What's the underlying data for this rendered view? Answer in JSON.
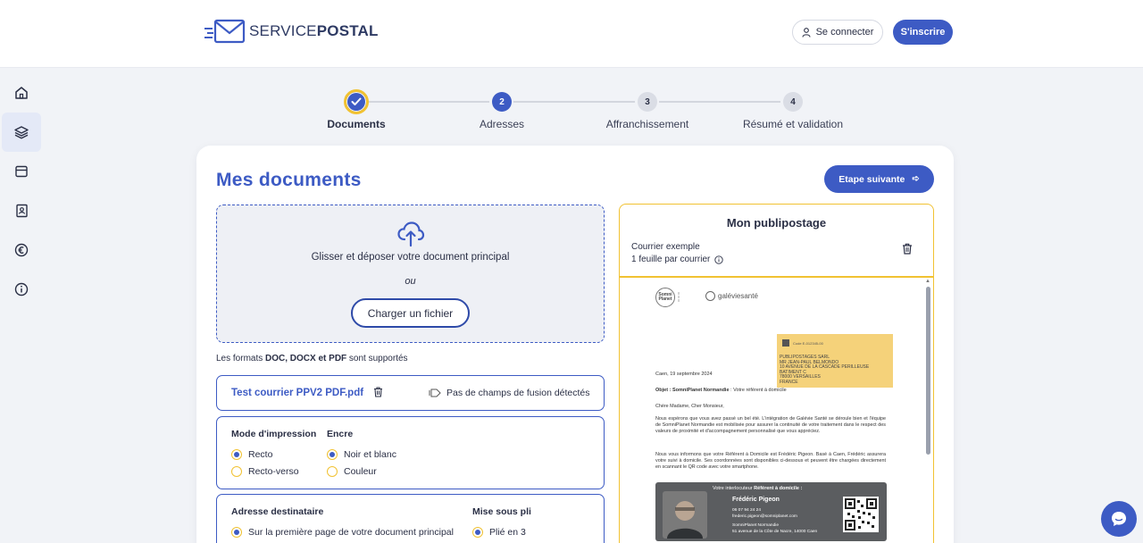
{
  "header": {
    "logo": {
      "light": "SERVICE",
      "bold": "POSTAL"
    },
    "login_label": "Se connecter",
    "signup_label": "S'inscrire"
  },
  "sidebar": {
    "items": [
      {
        "icon": "home-icon",
        "active": false
      },
      {
        "icon": "layers-icon",
        "active": true
      },
      {
        "icon": "archive-icon",
        "active": false
      },
      {
        "icon": "address-book-icon",
        "active": false
      },
      {
        "icon": "euro-icon",
        "active": false
      },
      {
        "icon": "info-icon",
        "active": false
      }
    ]
  },
  "stepper": {
    "steps": [
      {
        "number": "1",
        "label": "Documents",
        "state": "done"
      },
      {
        "number": "2",
        "label": "Adresses",
        "state": "current"
      },
      {
        "number": "3",
        "label": "Affranchissement",
        "state": "todo"
      },
      {
        "number": "4",
        "label": "Résumé et validation",
        "state": "todo"
      }
    ]
  },
  "main": {
    "title": "Mes documents",
    "next_label": "Etape suivante",
    "dropzone": {
      "text": "Glisser et déposer votre document principal",
      "or": "ou",
      "upload_label": "Charger un fichier"
    },
    "formats": {
      "prefix": "Les formats ",
      "list": "DOC, DOCX et PDF",
      "suffix": " sont supportés"
    },
    "file": {
      "name": "Test courrier PPV2 PDF.pdf",
      "merge_status": "Pas de champs de fusion détectés"
    },
    "print_mode": {
      "title": "Mode d'impression",
      "options": [
        "Recto",
        "Recto-verso"
      ],
      "selected": "Recto"
    },
    "ink": {
      "title": "Encre",
      "options": [
        "Noir et blanc",
        "Couleur"
      ],
      "selected": "Noir et blanc"
    },
    "recipient_address": {
      "title": "Adresse destinataire",
      "option": "Sur la première page de votre document principal"
    },
    "folding": {
      "title": "Mise sous pli",
      "option": "Plié en 3"
    }
  },
  "preview": {
    "title": "Mon publipostage",
    "sample": "Courrier exemple",
    "sheets": "1 feuille par courrier",
    "document": {
      "logo1_line1": "Somni",
      "logo1_line2": "Planet",
      "logo2": "galéviesanté",
      "code": "Code E-012345-00",
      "address_lines": [
        "PUBLIPOSTAGES SARL",
        "MR JEAN-PAUL BELMONDO",
        "10 AVENUE DE LA CASCADE PERILLEUSE",
        "BATIMENT C",
        "78000 VERSAILLES",
        "FRANCE"
      ],
      "date": "Caen, 19 septembre 2024",
      "object_label": "Objet : SomniPlanet Normandie",
      "object_rest": " : Votre référent à domicile",
      "greeting": "Chère Madame, Cher Monsieur,",
      "para1": "Nous espérons que vous avez passé un bel été. L'intégration de Galévie Santé se déroule bien et l'équipe de SomniPlanet Normandie est mobilisée pour assurer la continuité de votre traitement dans le respect des valeurs de proximité et d'accompagnement personnalisé que vous appréciez.",
      "para2": "Nous vous informons que votre Référent à Domicile est Frédéric Pigeon. Basé à Caen, Frédéric assurera votre suivi à domicile. Ses coordonnées sont disponibles ci-dessous et peuvent être chargées directement en scannant le QR code avec votre smartphone.",
      "contact_head_prefix": "Votre interlocuteur ",
      "contact_head_bold": "Référent à domicile :",
      "contact_name": "Frédéric Pigeon",
      "contact_phone": "06 07 94 24 24",
      "contact_email": "frederic.pigeon@somniplanet.com",
      "contact_company": "SomniPlanet Normandie",
      "contact_address": "51 avenue de la Côte de Nacre, 14000 Caen"
    }
  },
  "colors": {
    "primary": "#3d5bc4",
    "accent": "#f1c232",
    "background": "#f1f3f7"
  }
}
